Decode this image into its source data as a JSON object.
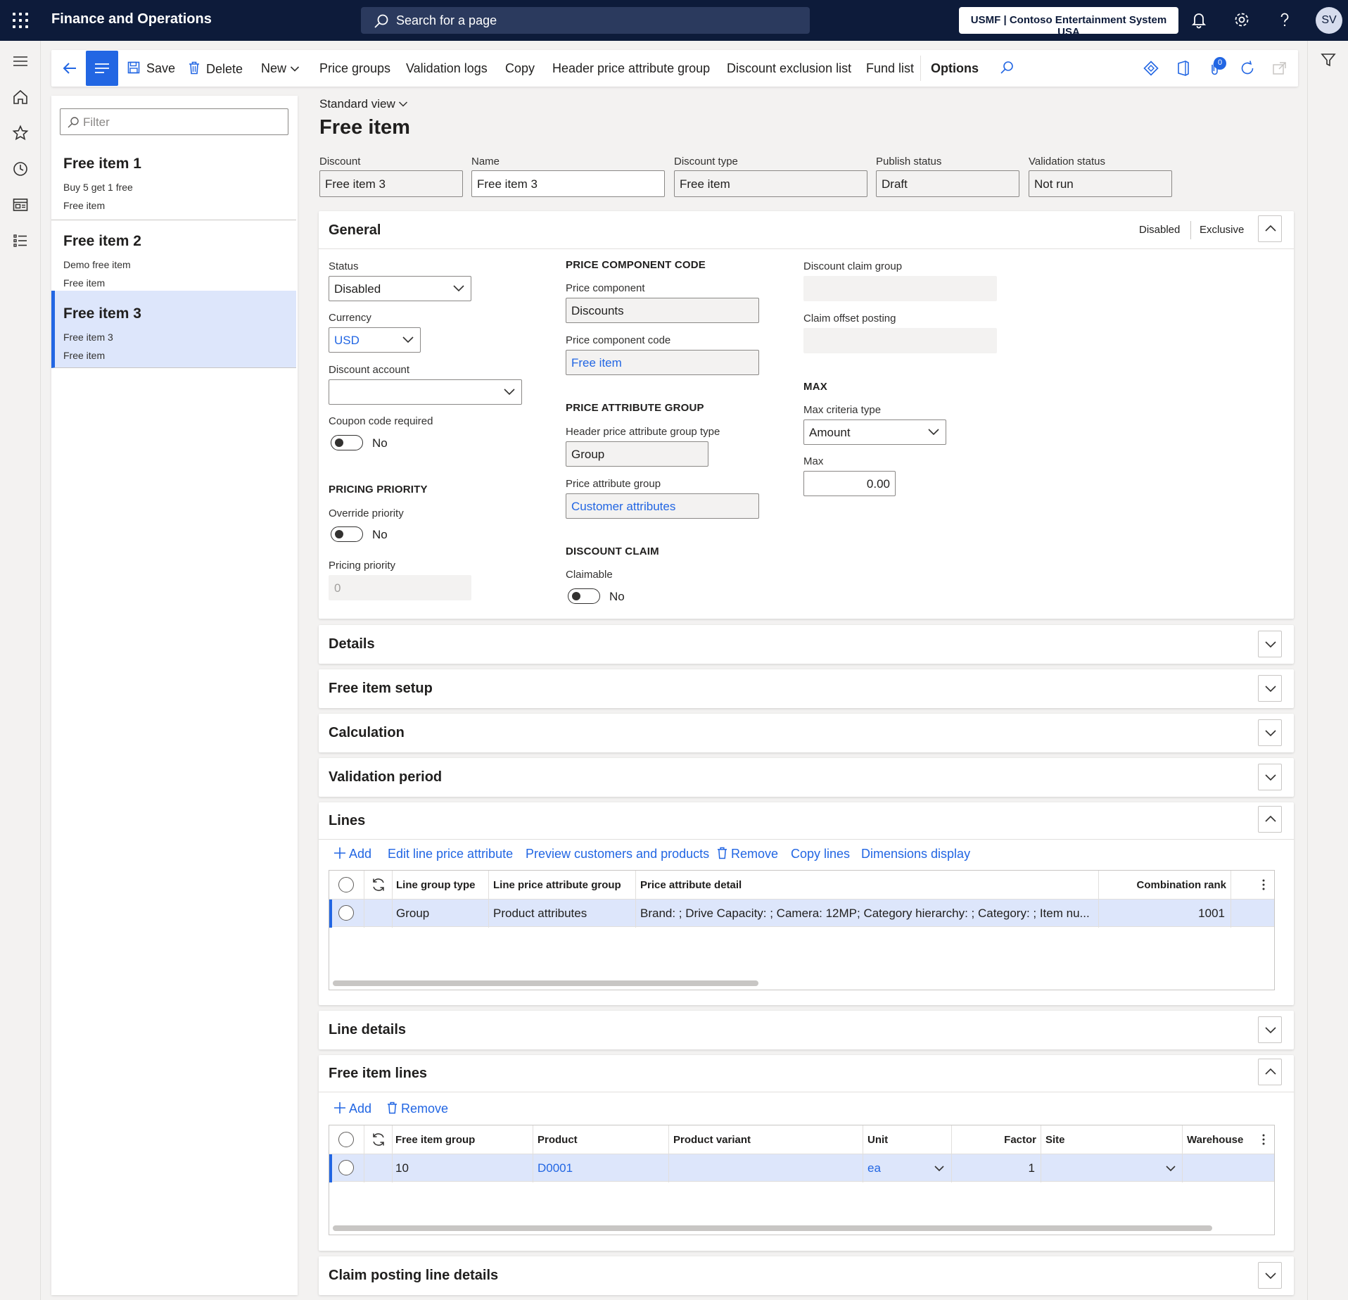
{
  "app": {
    "title": "Finance and Operations",
    "search_placeholder": "Search for a page",
    "company": "USMF | Contoso Entertainment System USA",
    "user_initials": "SV"
  },
  "actions": {
    "save": "Save",
    "delete": "Delete",
    "new": "New",
    "price_groups": "Price groups",
    "validation_logs": "Validation logs",
    "copy": "Copy",
    "header_price_attribute_group": "Header price attribute group",
    "discount_exclusion_list": "Discount exclusion list",
    "fund_list": "Fund list",
    "options": "Options",
    "notification_count": "0"
  },
  "list": {
    "filter_placeholder": "Filter",
    "items": [
      {
        "title": "Free item 1",
        "line1": "Buy 5 get 1 free",
        "line2": "Free item"
      },
      {
        "title": "Free item 2",
        "line1": "Demo free item",
        "line2": "Free item"
      },
      {
        "title": "Free item 3",
        "line1": "Free item 3",
        "line2": "Free item"
      }
    ]
  },
  "page": {
    "view": "Standard view",
    "title": "Free item"
  },
  "header": {
    "discount_label": "Discount",
    "discount_value": "Free item 3",
    "name_label": "Name",
    "name_value": "Free item 3",
    "discount_type_label": "Discount type",
    "discount_type_value": "Free item",
    "publish_status_label": "Publish status",
    "publish_status_value": "Draft",
    "validation_status_label": "Validation status",
    "validation_status_value": "Not run"
  },
  "general": {
    "title": "General",
    "summary_status": "Disabled",
    "summary_mode": "Exclusive",
    "status_label": "Status",
    "status_value": "Disabled",
    "currency_label": "Currency",
    "currency_value": "USD",
    "discount_account_label": "Discount account",
    "discount_account_value": "",
    "coupon_label": "Coupon code required",
    "coupon_value": "No",
    "pricing_priority_head": "PRICING PRIORITY",
    "override_label": "Override priority",
    "override_value": "No",
    "pricing_priority_label": "Pricing priority",
    "pricing_priority_value": "0",
    "price_component_head": "PRICE COMPONENT CODE",
    "price_component_label": "Price component",
    "price_component_value": "Discounts",
    "price_component_code_label": "Price component code",
    "price_component_code_value": "Free item",
    "price_attribute_head": "PRICE ATTRIBUTE GROUP",
    "header_group_type_label": "Header price attribute group type",
    "header_group_type_value": "Group",
    "price_attribute_group_label": "Price attribute group",
    "price_attribute_group_value": "Customer attributes",
    "discount_claim_head": "DISCOUNT CLAIM",
    "claimable_label": "Claimable",
    "claimable_value": "No",
    "discount_claim_group_label": "Discount claim group",
    "claim_offset_label": "Claim offset posting",
    "max_head": "MAX",
    "max_criteria_label": "Max criteria type",
    "max_criteria_value": "Amount",
    "max_label": "Max",
    "max_value": "0.00"
  },
  "sections": {
    "details": "Details",
    "free_item_setup": "Free item setup",
    "calculation": "Calculation",
    "validation_period": "Validation period",
    "lines": "Lines",
    "line_details": "Line details",
    "free_item_lines": "Free item lines",
    "claim_posting": "Claim posting line details"
  },
  "lines": {
    "tools": {
      "add": "Add",
      "edit": "Edit line price attribute",
      "preview": "Preview customers and products",
      "remove": "Remove",
      "copy": "Copy lines",
      "dimensions": "Dimensions display"
    },
    "columns": {
      "group_type": "Line group type",
      "attr_group": "Line price attribute group",
      "attr_detail": "Price attribute detail",
      "rank": "Combination rank"
    },
    "rows": [
      {
        "group_type": "Group",
        "attr_group": "Product attributes",
        "attr_detail": "Brand: ; Drive Capacity: ; Camera: 12MP; Category hierarchy: ; Category: ; Item nu...",
        "rank": "1001"
      }
    ]
  },
  "free_item_lines": {
    "tools": {
      "add": "Add",
      "remove": "Remove"
    },
    "columns": {
      "group": "Free item group",
      "product": "Product",
      "variant": "Product variant",
      "unit": "Unit",
      "factor": "Factor",
      "site": "Site",
      "warehouse": "Warehouse"
    },
    "rows": [
      {
        "group": "10",
        "product": "D0001",
        "variant": "",
        "unit": "ea",
        "factor": "1",
        "site": "",
        "warehouse": ""
      }
    ]
  }
}
